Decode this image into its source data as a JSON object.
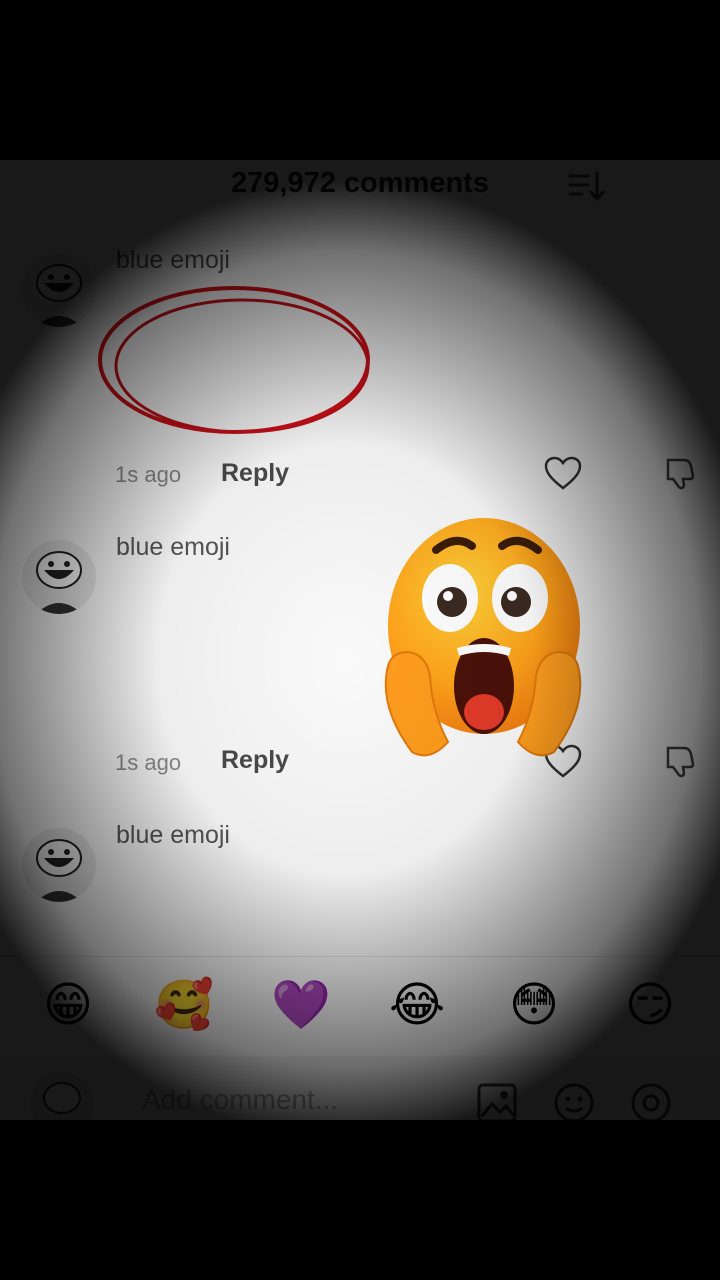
{
  "header": {
    "title": "279,972 comments",
    "sort_icon": "sort-icon"
  },
  "comments": [
    {
      "username": "blue emoji",
      "time": "1s ago",
      "reply": "Reply"
    },
    {
      "username": "blue emoji",
      "time": "1s ago",
      "reply": "Reply"
    },
    {
      "username": "blue emoji"
    }
  ],
  "overlays": {
    "circle_color": "#d01017",
    "sticker": "shocked-face-sticker"
  },
  "emoji_bar": [
    "😁",
    "🥰",
    "💜",
    "😂",
    "😳",
    "😏"
  ],
  "composer": {
    "placeholder": "Add comment..."
  }
}
